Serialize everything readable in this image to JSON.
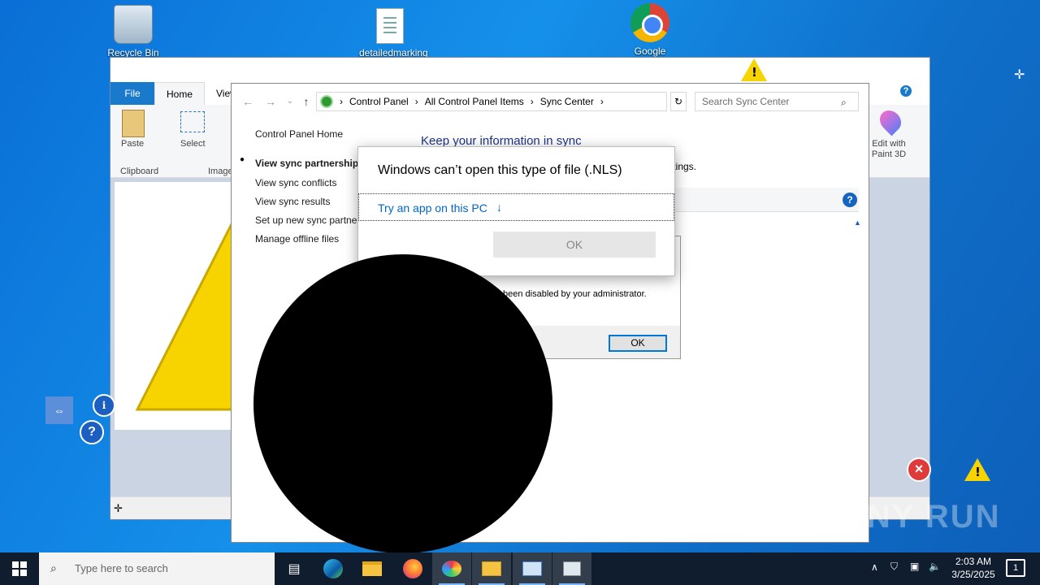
{
  "desktop": {
    "icons": [
      {
        "label": "Recycle Bin"
      },
      {
        "label": "detailedmarking"
      },
      {
        "label": "Google Chrome"
      }
    ]
  },
  "paint": {
    "tabs": {
      "file": "File",
      "home": "Home",
      "view": "View"
    },
    "ribbon": {
      "paste": "Paste",
      "clipboard": "Clipboard",
      "select": "Select",
      "image": "Image",
      "edit_paint3d": "Edit with Paint 3D"
    }
  },
  "control_panel": {
    "breadcrumb": [
      "Control Panel",
      "All Control Panel Items",
      "Sync Center"
    ],
    "search_placeholder": "Search Sync Center",
    "sidebar": [
      "Control Panel Home",
      "View sync partnerships",
      "View sync conflicts",
      "View sync results",
      "Set up new sync partner",
      "Manage offline files"
    ],
    "heading": "Keep your information in sync",
    "body_fragment": "ttings."
  },
  "openwith_dialog": {
    "title": "Windows can’t open this type of file (.NLS)",
    "link": "Try an app on this PC",
    "ok": "OK"
  },
  "disabled_dialog": {
    "message_fragment": "been disabled by your administrator.",
    "ok": "OK"
  },
  "taskbar": {
    "search_placeholder": "Type here to search",
    "time": "2:03 AM",
    "date": "3/25/2025"
  },
  "watermark": "ANY RUN",
  "colors": {
    "accent": "#1979ca",
    "link": "#0066cc",
    "warning": "#f7d400",
    "taskbar": "#101d2e"
  }
}
